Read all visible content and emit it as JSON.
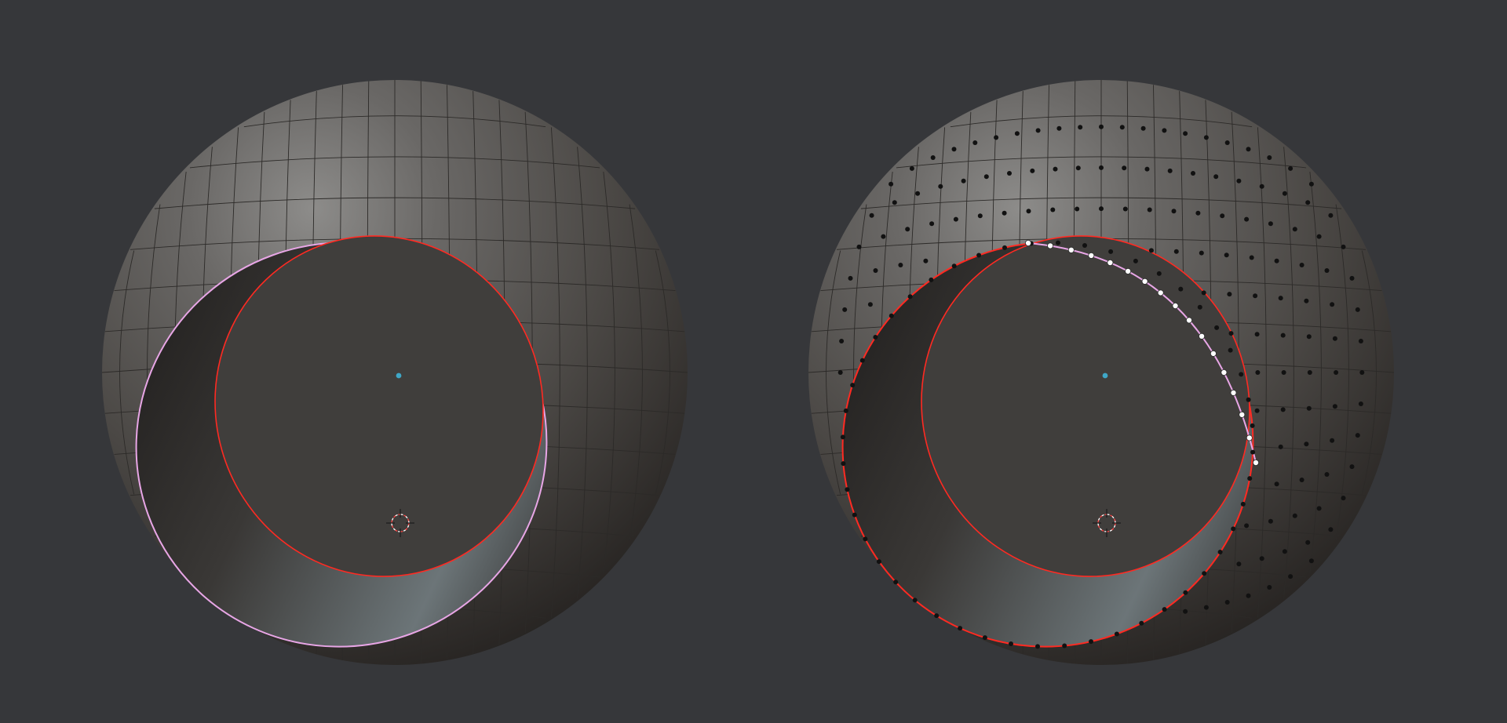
{
  "viewport": {
    "editor": "3D Viewport",
    "background_color": "#36373a"
  },
  "objects": [
    {
      "name": "left-sphere",
      "mode": "object",
      "vertices_shown": false,
      "mesh_color": "#57544f",
      "hole_rim_color": "#e8a6e6",
      "boundary_color": "#ff2a22"
    },
    {
      "name": "right-sphere",
      "mode": "edit",
      "vertices_shown": true,
      "mesh_color": "#57544f",
      "hole_rim_color": "#e8a6e6",
      "boundary_color": "#ff2a22",
      "selected_vertex_color": "#ffffff",
      "vertex_color": "#111111",
      "selected_edge_color": "#3aa3c9"
    }
  ],
  "markers": {
    "origin_color": "#3fa7c7",
    "cursor_ring_color": "#ff4444",
    "cursor_cross_color": "#1a1a1a"
  }
}
